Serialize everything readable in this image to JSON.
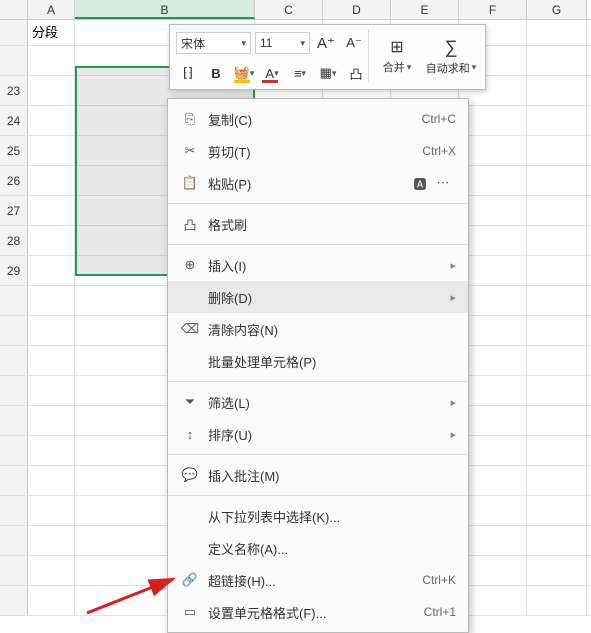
{
  "columns": [
    "A",
    "B",
    "C",
    "D",
    "E",
    "F",
    "G"
  ],
  "rows": [
    "",
    "",
    "23",
    "24",
    "25",
    "26",
    "27",
    "28",
    "29",
    "",
    "",
    "",
    "",
    "",
    "",
    "",
    "",
    "",
    "",
    ""
  ],
  "special_cell_A1": "分段显示",
  "toolbar": {
    "font": "宋体",
    "size": "11",
    "big_a": "A⁺",
    "small_a": "A⁻",
    "merge_label": "合并",
    "sum_label": "自动求和"
  },
  "context_menu": {
    "copy": "复制(C)",
    "copy_key": "Ctrl+C",
    "cut": "剪切(T)",
    "cut_key": "Ctrl+X",
    "paste": "粘贴(P)",
    "format_painter": "格式刷",
    "insert": "插入(I)",
    "delete": "删除(D)",
    "clear": "清除内容(N)",
    "batch": "批量处理单元格(P)",
    "filter": "筛选(L)",
    "sort": "排序(U)",
    "comment": "插入批注(M)",
    "dropdown_pick": "从下拉列表中选择(K)...",
    "define_name": "定义名称(A)...",
    "hyperlink": "超链接(H)...",
    "hyperlink_key": "Ctrl+K",
    "format_cells": "设置单元格格式(F)...",
    "format_cells_key": "Ctrl+1"
  }
}
